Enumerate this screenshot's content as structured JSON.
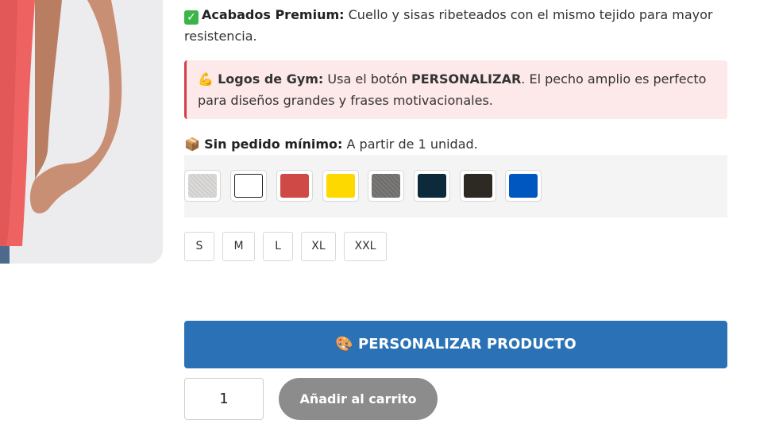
{
  "features": {
    "premium": {
      "label": "Acabados Premium:",
      "text": " Cuello y sisas ribeteados con el mismo tejido para mayor resistencia."
    },
    "gym_logos": {
      "emoji": "💪",
      "label": "Logos de Gym:",
      "text_before": " Usa el botón ",
      "highlight": "PERSONALIZAR",
      "text_after": ". El pecho amplio es perfecto para diseños grandes y frases motivacionales."
    },
    "min_order": {
      "emoji": "📦",
      "label": "Sin pedido mínimo:",
      "text": " A partir de 1 unidad."
    }
  },
  "colors": [
    {
      "name": "heather-grey",
      "hex": "#d0cfcd"
    },
    {
      "name": "white",
      "hex": "#ffffff"
    },
    {
      "name": "red",
      "hex": "#cf4a46"
    },
    {
      "name": "yellow",
      "hex": "#fdd900"
    },
    {
      "name": "dark-heather",
      "hex": "#737170"
    },
    {
      "name": "navy",
      "hex": "#0c2a39"
    },
    {
      "name": "black",
      "hex": "#2c2a23"
    },
    {
      "name": "royal-blue",
      "hex": "#0057c0"
    }
  ],
  "sizes": [
    "S",
    "M",
    "L",
    "XL",
    "XXL"
  ],
  "actions": {
    "personalize_emoji": "🎨",
    "personalize_label": "PERSONALIZAR PRODUCTO",
    "quantity": "1",
    "add_to_cart_label": "Añadir al carrito"
  },
  "theme": {
    "primary": "#2a72b5",
    "alert_bg": "#fde8ea",
    "alert_border": "#d33f49",
    "disabled_button": "#8c8c8c"
  }
}
